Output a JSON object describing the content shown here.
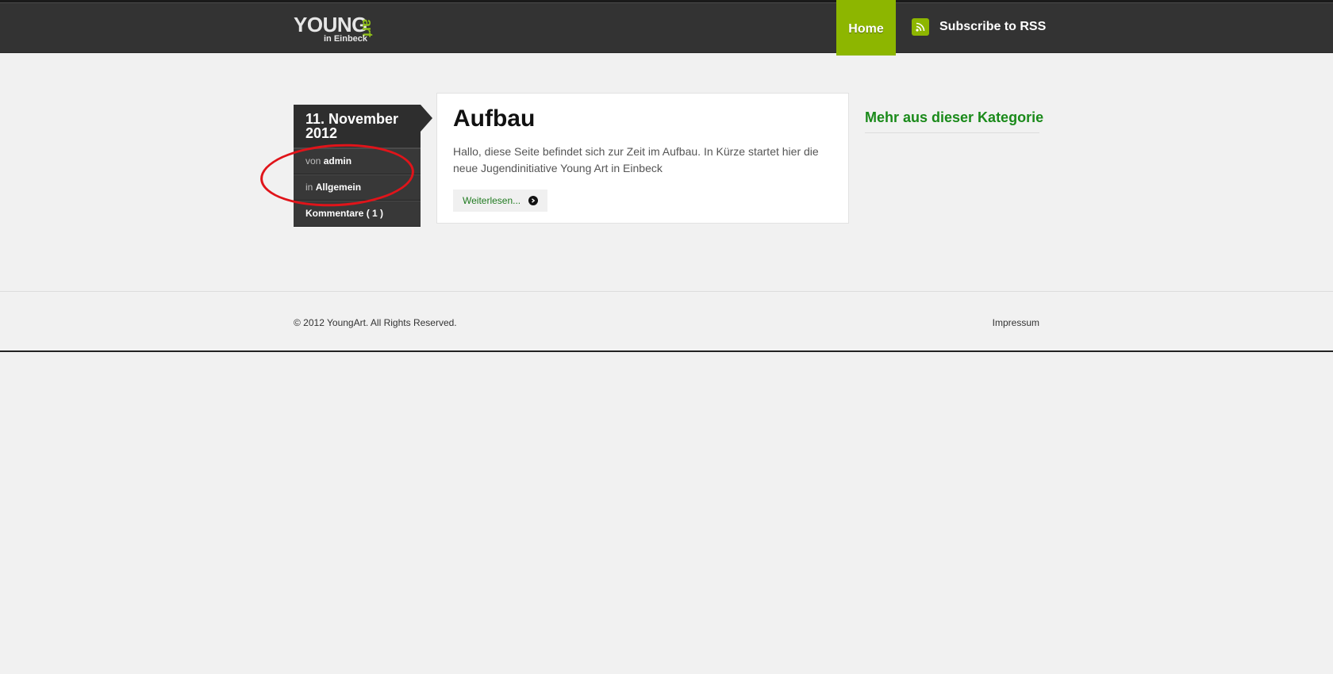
{
  "header": {
    "logo": {
      "main": "YOUNG",
      "accent": "art",
      "sub": "in Einbeck"
    },
    "nav": {
      "home_label": "Home",
      "rss_label": "Subscribe to RSS"
    }
  },
  "post": {
    "date": "11. November 2012",
    "author_prefix": "von",
    "author": "admin",
    "category_prefix": "in",
    "category": "Allgemein",
    "comments": "Kommentare ( 1 )",
    "title": "Aufbau",
    "body": "Hallo, diese Seite befindet sich zur Zeit im Aufbau.   In Kürze startet hier die neue Jugendinitiative Young Art in Einbeck",
    "read_more": "Weiterlesen..."
  },
  "sidebar": {
    "title": "Mehr aus dieser Kategorie"
  },
  "footer": {
    "copyright": "© 2012 YoungArt. All Rights Reserved.",
    "impressum": "Impressum"
  },
  "colors": {
    "accent_green": "#8db600",
    "header_bg": "#333333",
    "link_green": "#1a8a1a",
    "annotation_red": "#e0141a"
  }
}
